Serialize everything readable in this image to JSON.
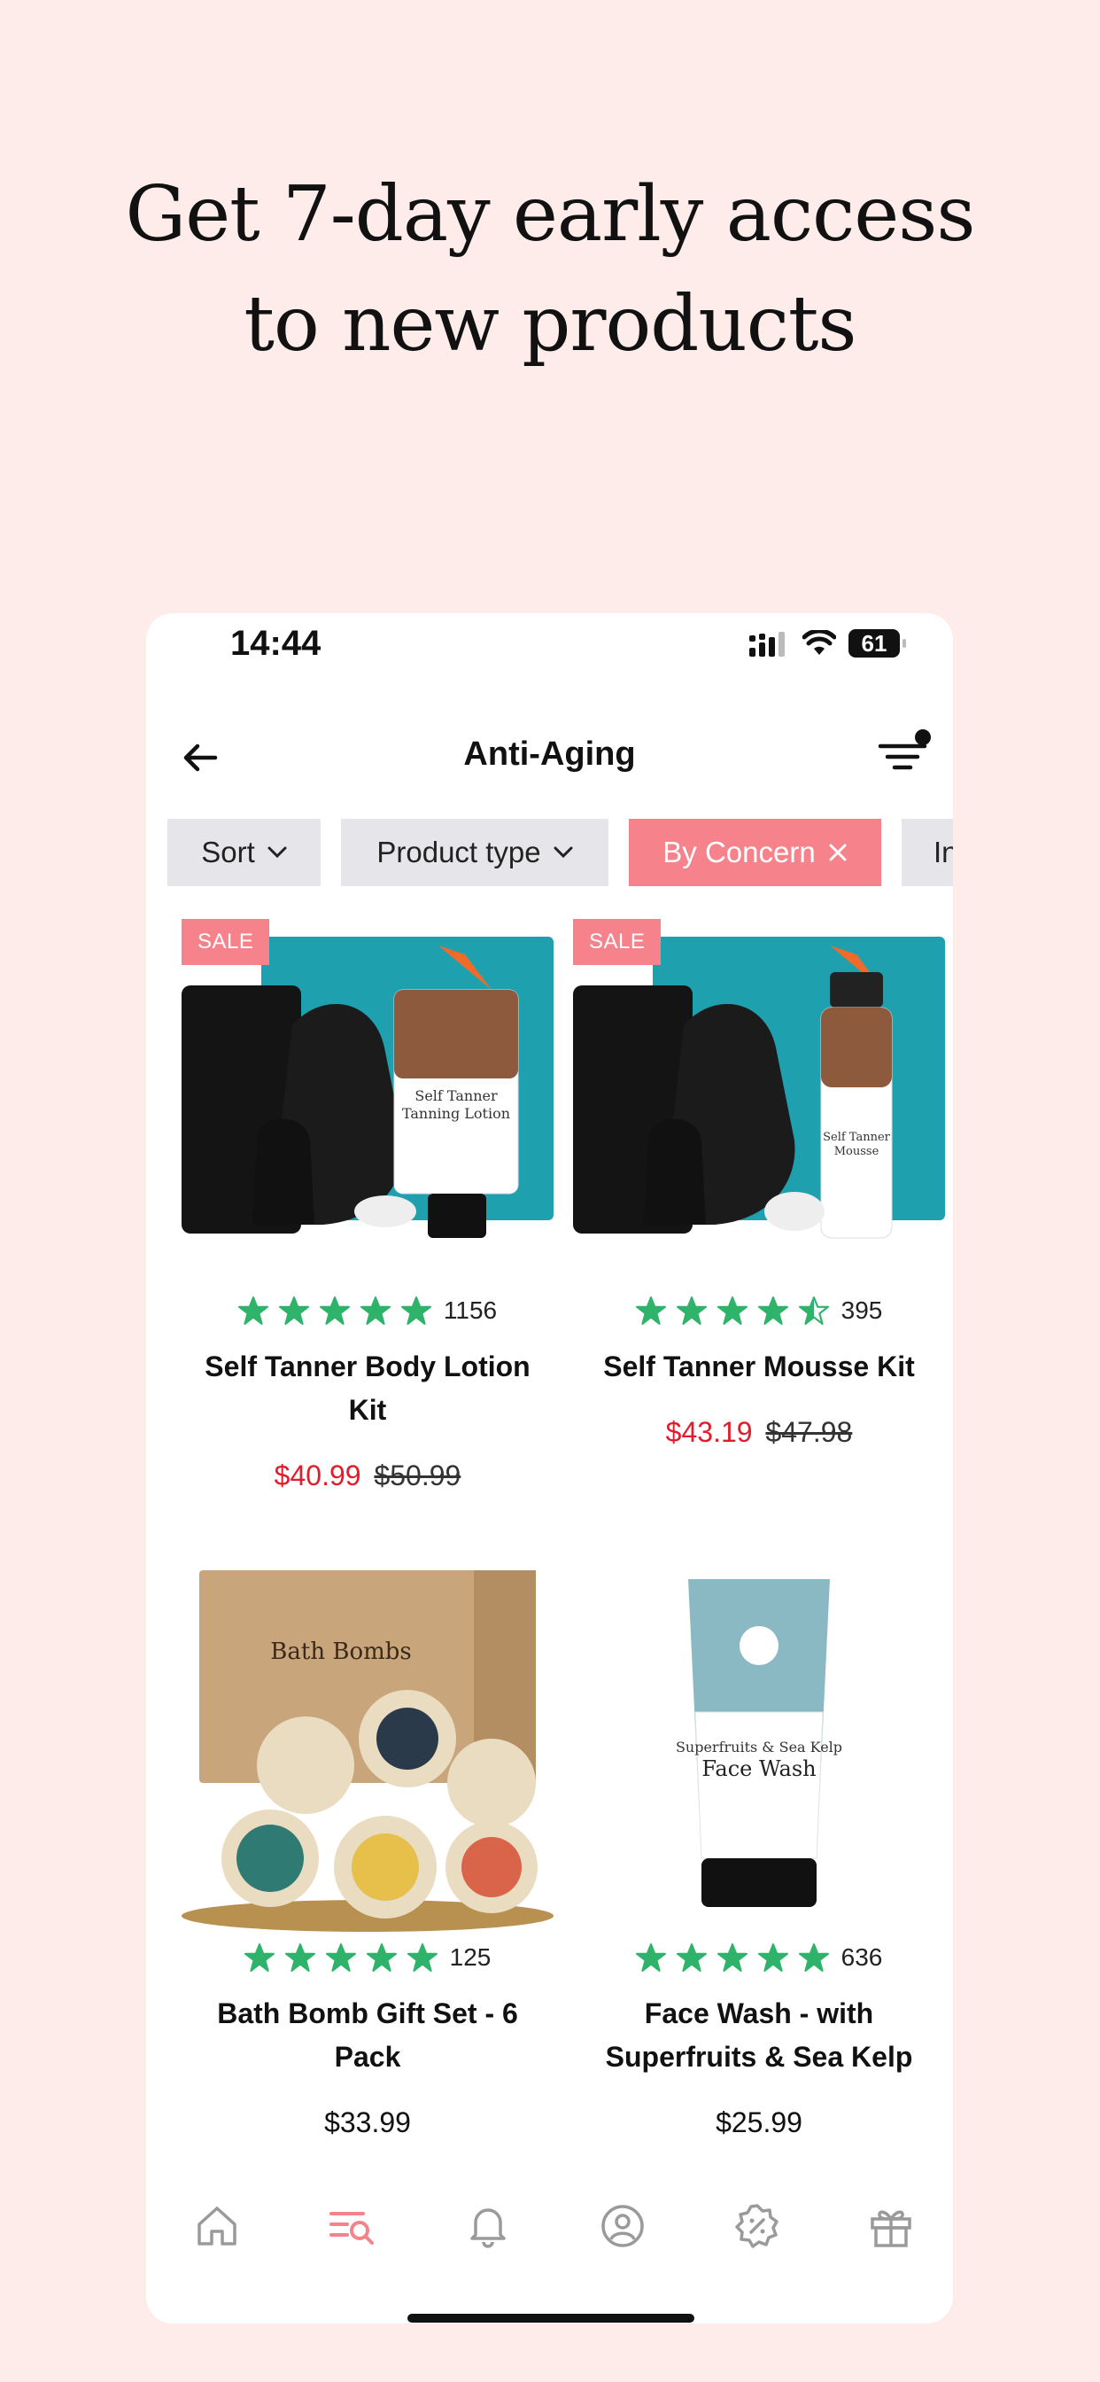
{
  "headline": {
    "line1": "Get 7-day early access",
    "line2": "to new products"
  },
  "status_bar": {
    "time": "14:44",
    "battery": "61"
  },
  "nav": {
    "title": "Anti-Aging"
  },
  "filters": {
    "sort": "Sort",
    "product_type": "Product type",
    "concern": "By Concern",
    "partial": "In"
  },
  "products": [
    {
      "badge": "SALE",
      "rating": 5,
      "reviews": "1156",
      "name": "Self Tanner Body Lotion Kit",
      "price": "$40.99",
      "old_price": "$50.99",
      "image": "self-tanner-lotion-kit"
    },
    {
      "badge": "SALE",
      "rating": 4.5,
      "reviews": "395",
      "name": "Self Tanner Mousse Kit",
      "price": "$43.19",
      "old_price": "$47.98",
      "image": "self-tanner-mousse-kit"
    },
    {
      "badge": "",
      "rating": 5,
      "reviews": "125",
      "name": "Bath Bomb Gift Set - 6 Pack",
      "price": "$33.99",
      "old_price": "",
      "image": "bath-bombs-box"
    },
    {
      "badge": "",
      "rating": 5,
      "reviews": "636",
      "name": "Face Wash - with Superfruits & Sea Kelp",
      "price": "$25.99",
      "old_price": "",
      "image": "face-wash-tube"
    }
  ],
  "tabbar": [
    "home-icon",
    "search-list-icon",
    "bell-icon",
    "profile-icon",
    "discount-icon",
    "gift-icon"
  ],
  "colors": {
    "accent": "#f6828b",
    "star": "#2fb36b",
    "sale_price": "#e11d2b",
    "background": "#fdecea"
  }
}
